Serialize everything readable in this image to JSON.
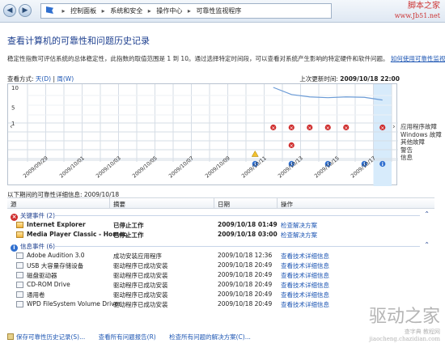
{
  "window": {
    "breadcrumb": [
      "控制面板",
      "系统和安全",
      "操作中心",
      "可靠性监视程序"
    ]
  },
  "watermark": {
    "title": "脚本之家",
    "url": "www.Jb51.net"
  },
  "page": {
    "title": "查看计算机的可靠性和问题历史记录",
    "description": "稳定性指数可评估系统的总体稳定性，此指数的取值范围是 1 到 10。通过选择特定时间段，可以查看对系统产生影响的特定硬件和软件问题。",
    "learn_more": "如何使用可靠性监视程序..."
  },
  "view": {
    "label": "查看方式:",
    "day": "天(D)",
    "sep": "|",
    "week": "周(W)"
  },
  "last_updated": {
    "label": "上次更新时间:",
    "value": "2009/10/18 22:00"
  },
  "chart_data": {
    "type": "line",
    "title": "",
    "ylim": [
      1,
      10
    ],
    "y_ticks": [
      "10",
      "5",
      "1"
    ],
    "x": [
      "2009/09/29",
      "2009/09/30",
      "2009/10/01",
      "2009/10/02",
      "2009/10/03",
      "2009/10/04",
      "2009/10/05",
      "2009/10/06",
      "2009/10/07",
      "2009/10/08",
      "2009/10/09",
      "2009/10/10",
      "2009/10/11",
      "2009/10/12",
      "2009/10/13",
      "2009/10/14",
      "2009/10/15",
      "2009/10/16",
      "2009/10/17",
      "2009/10/18"
    ],
    "x_tick_labels": [
      "2009/09/29",
      "2009/10/01",
      "2009/10/03",
      "2009/10/05",
      "2009/10/07",
      "2009/10/09",
      "2009/10/11",
      "2009/10/13",
      "2009/10/15",
      "2009/10/17"
    ],
    "series": [
      {
        "values": [
          null,
          null,
          null,
          null,
          null,
          null,
          null,
          null,
          null,
          null,
          null,
          null,
          null,
          10,
          8.2,
          7.6,
          7.4,
          7.6,
          7.5,
          6.8
        ]
      }
    ],
    "row_labels": [
      "应用程序故障",
      "Windows 故障",
      "其他故障",
      "警告",
      "信息"
    ],
    "markers": {
      "app_failures": [
        "2009/10/12",
        "2009/10/13",
        "2009/10/14",
        "2009/10/15",
        "2009/10/16",
        "2009/10/18"
      ],
      "other_failures": [
        "2009/10/13"
      ],
      "warnings": [
        "2009/10/11"
      ],
      "information": [
        "2009/10/11",
        "2009/10/13",
        "2009/10/15",
        "2009/10/17",
        "2009/10/18"
      ]
    },
    "selected": "2009/10/18",
    "colors": {
      "line": "#6b9bd6",
      "error": "#cf2e2e",
      "warning": "#f3c12e",
      "info": "#2f6fcf",
      "selected": "#d7ebfb"
    }
  },
  "details": {
    "label": "以下期间的可靠性详细信息: 2009/10/18",
    "columns": [
      "源",
      "摘要",
      "日期",
      "操作"
    ],
    "critical_group": "关键事件 (2)",
    "info_group": "信息事件 (6)",
    "critical_rows": [
      {
        "source": "Internet Explorer",
        "summary": "已停止工作",
        "date": "2009/10/18 01:49",
        "action": "检查解决方案"
      },
      {
        "source": "Media Player Classic - Homec...",
        "summary": "已停止工作",
        "date": "2009/10/18 03:00",
        "action": "检查解决方案"
      }
    ],
    "info_rows": [
      {
        "source": "Adobe Audition 3.0",
        "summary": "成功安装应用程序",
        "date": "2009/10/18 12:36",
        "action": "查看技术详细信息"
      },
      {
        "source": "USB 大容量存储设备",
        "summary": "驱动程序已成功安装",
        "date": "2009/10/18 20:49",
        "action": "查看技术详细信息"
      },
      {
        "source": "磁盘驱动器",
        "summary": "驱动程序已成功安装",
        "date": "2009/10/18 20:49",
        "action": "查看技术详细信息"
      },
      {
        "source": "CD-ROM Drive",
        "summary": "驱动程序已成功安装",
        "date": "2009/10/18 20:49",
        "action": "查看技术详细信息"
      },
      {
        "source": "通用卷",
        "summary": "驱动程序已成功安装",
        "date": "2009/10/18 20:49",
        "action": "查看技术详细信息"
      },
      {
        "source": "WPD FileSystem Volume Driver",
        "summary": "驱动程序已成功安装",
        "date": "2009/10/18 20:49",
        "action": "查看技术详细信息"
      }
    ]
  },
  "footer": {
    "save": "保存可靠性历史记录(S)...",
    "view_reports": "查看所有问题报告(R)",
    "check_solutions": "检查所有问题的解决方案(C)..."
  },
  "logo": {
    "text": "驱动之家",
    "sub": "查字典 教程网",
    "url": "jiaocheng.chazidian.com"
  }
}
